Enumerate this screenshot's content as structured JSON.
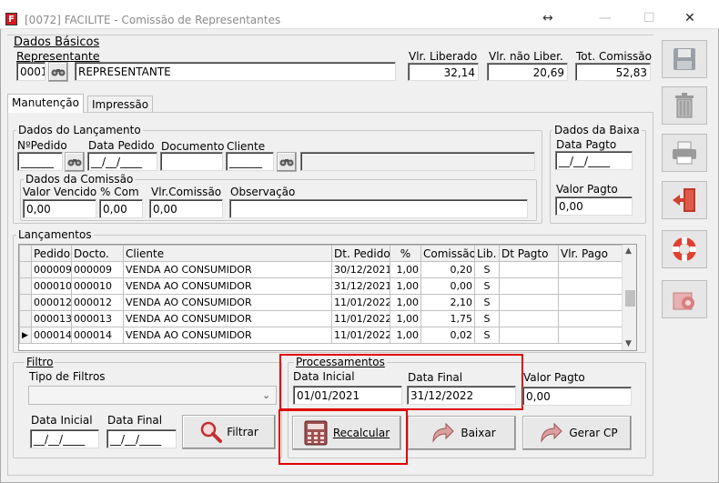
{
  "window": {
    "title": "[0072] FACILITE - Comissão de Representantes",
    "resize_icon": "↔",
    "minimize_icon": "—",
    "maximize_icon": "☐",
    "close_icon": "✕"
  },
  "dados_basicos": {
    "title": "Dados Básicos",
    "representante_label": "Representante",
    "representante_code": "0001",
    "representante_name": "REPRESENTANTE",
    "vlr_liberado_label": "Vlr. Liberado",
    "vlr_liberado": "32,14",
    "vlr_nao_liber_label": "Vlr. não Liber.",
    "vlr_nao_liber": "20,69",
    "tot_comissao_label": "Tot. Comissão",
    "tot_comissao": "52,83"
  },
  "tabs": [
    {
      "label": "Manutenção"
    },
    {
      "label": "Impressão"
    }
  ],
  "lancamento": {
    "title": "Dados do Lançamento",
    "pedido_label": "NºPedido",
    "pedido_value": "______",
    "data_pedido_label": "Data Pedido",
    "data_pedido_value": "__/__/____",
    "documento_label": "Documento",
    "documento_value": "",
    "cliente_label": "Cliente",
    "cliente_value": "______",
    "cliente_name": "",
    "comissao_title": "Dados da Comissão",
    "valor_vencido_label": "Valor Vencido",
    "valor_vencido": "0,00",
    "pct_com_label": "% Com",
    "pct_com": "0,00",
    "vlr_comissao_label": "Vlr.Comissão",
    "vlr_comissao": "0,00",
    "observacao_label": "Observação",
    "observacao": ""
  },
  "baixa": {
    "title": "Dados da Baixa",
    "data_pagto_label": "Data Pagto",
    "data_pagto_value": "__/__/____",
    "valor_pagto_label": "Valor Pagto",
    "valor_pagto": "0,00"
  },
  "lancamentos": {
    "title": "Lançamentos",
    "columns": [
      "Pedido",
      "Docto.",
      "Cliente",
      "Dt. Pedido",
      "%",
      "Comissão",
      "Lib.",
      "Dt Pagto",
      "Vlr. Pago"
    ],
    "rows": [
      [
        "000009",
        "000009",
        "VENDA AO CONSUMIDOR",
        "30/12/2021",
        "1,00",
        "0,20",
        "S",
        "",
        ""
      ],
      [
        "000010",
        "000010",
        "VENDA AO CONSUMIDOR",
        "31/12/2021",
        "1,00",
        "0,00",
        "S",
        "",
        ""
      ],
      [
        "000012",
        "000012",
        "VENDA AO CONSUMIDOR",
        "11/01/2022",
        "1,00",
        "2,10",
        "S",
        "",
        ""
      ],
      [
        "000013",
        "000013",
        "VENDA AO CONSUMIDOR",
        "11/01/2022",
        "1,00",
        "1,75",
        "S",
        "",
        ""
      ],
      [
        "000014",
        "000014",
        "VENDA AO CONSUMIDOR",
        "11/01/2022",
        "1,00",
        "0,02",
        "S",
        "",
        ""
      ]
    ],
    "current_row_marker": "▶"
  },
  "filtro": {
    "title": "Filtro",
    "tipo_label": "Tipo de Filtros",
    "tipo_value": "",
    "data_inicial_label": "Data Inicial",
    "data_inicial_value": "__/__/____",
    "data_final_label": "Data Final",
    "data_final_value": "__/__/____",
    "filtrar_label": "Filtrar"
  },
  "processamentos": {
    "title": "Processamentos",
    "data_inicial_label": "Data Inicial",
    "data_inicial_value": "01/01/2021",
    "data_final_label": "Data Final",
    "data_final_value": "31/12/2022",
    "valor_pagto_label": "Valor Pagto",
    "valor_pagto_value": "0,00",
    "recalcular_label": "Recalcular",
    "baixar_label": "Baixar",
    "gerar_cp_label": "Gerar CP"
  },
  "colors": {
    "highlight": "#e00000"
  }
}
